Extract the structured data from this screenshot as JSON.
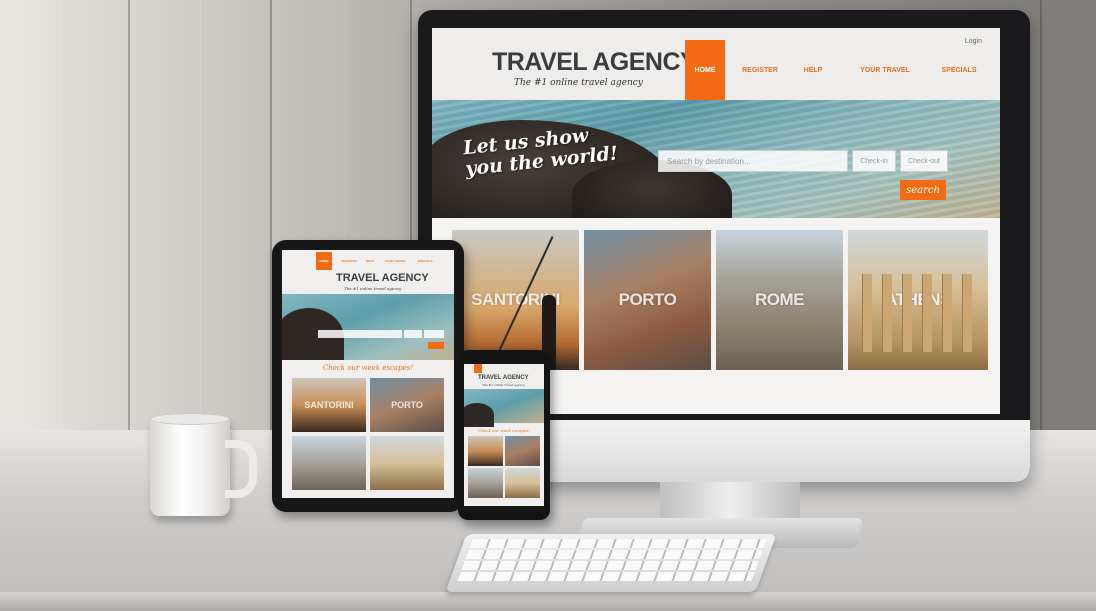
{
  "site": {
    "login": "Login",
    "logo_title": "TRAVEL AGENCY",
    "logo_subtitle": "The #1 online travel agency",
    "nav": [
      {
        "label": "HOME",
        "active": true
      },
      {
        "label": "REGISTER",
        "active": false
      },
      {
        "label": "HELP",
        "active": false
      },
      {
        "label": "YOUR TRAVEL",
        "active": false
      },
      {
        "label": "SPECIALS",
        "active": false
      }
    ],
    "hero_slogan": "Let us show you the world!",
    "search_placeholder": "Search by destination...",
    "check_in": "Check-in",
    "check_out": "Check-out",
    "search_button": "search",
    "destinations": [
      "SANTORINI",
      "PORTO",
      "ROME",
      "ATHENS"
    ],
    "mobile_heading": "Check our week escapes!"
  },
  "colors": {
    "accent": "#f26b13",
    "logo_text": "#3c3c3c"
  }
}
